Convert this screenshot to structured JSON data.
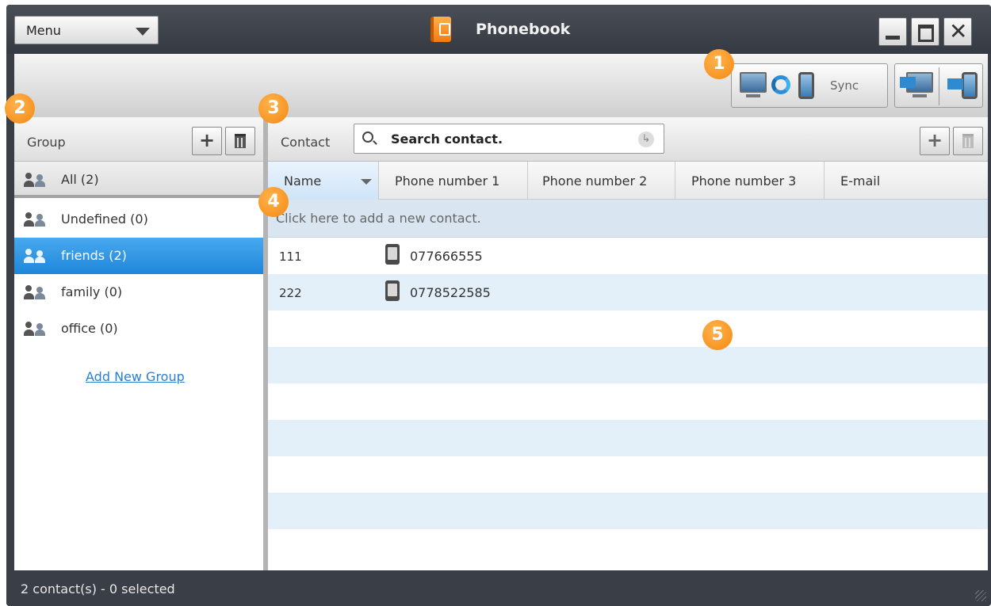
{
  "window": {
    "title": "Phonebook",
    "menu_label": "Menu"
  },
  "toolbar": {
    "sync_label": "Sync"
  },
  "groups": {
    "header_label": "Group",
    "all": "All (2)",
    "items": [
      {
        "label": "Undefined (0)",
        "selected": false
      },
      {
        "label": "friends (2)",
        "selected": true
      },
      {
        "label": "family (0)",
        "selected": false
      },
      {
        "label": "office (0)",
        "selected": false
      }
    ],
    "add_link": "Add New Group"
  },
  "contacts": {
    "header_label": "Contact",
    "search_placeholder": "Search contact.",
    "columns": [
      "Name",
      "Phone number 1",
      "Phone number 2",
      "Phone number 3",
      "E-mail"
    ],
    "add_row_text": "Click here to add a new contact.",
    "rows": [
      {
        "name": "111",
        "phone1": "077666555"
      },
      {
        "name": "222",
        "phone1": "0778522585"
      }
    ]
  },
  "status": {
    "text": "2 contact(s) - 0 selected"
  },
  "callouts": [
    "1",
    "2",
    "3",
    "4",
    "5"
  ],
  "colors": {
    "selected_group": "#2a8ee0",
    "callout": "#f58d12",
    "alt_row": "#e3eff9"
  }
}
